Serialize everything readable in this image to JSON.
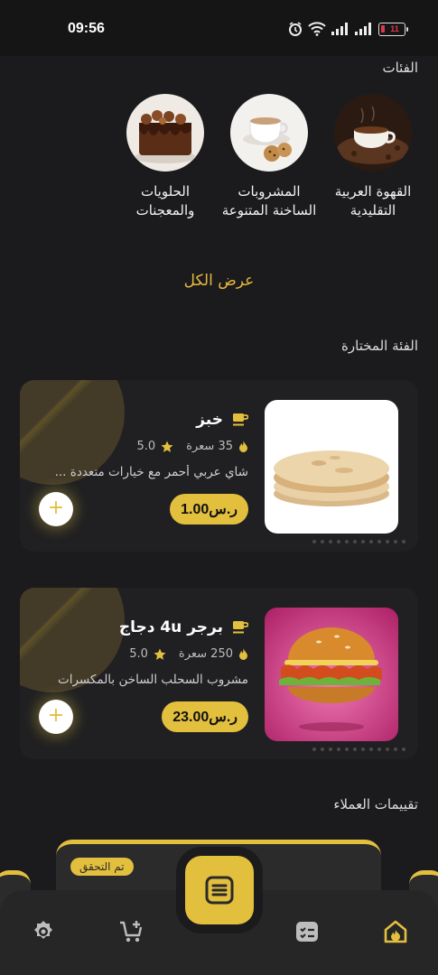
{
  "status_bar": {
    "time": "09:56",
    "battery": "11"
  },
  "categories_section": {
    "title": "الفئات",
    "items": [
      {
        "label": "القهوة العربية التقليدية",
        "icon": "arabic-coffee-photo"
      },
      {
        "label": "المشروبات الساخنة المتنوعة",
        "icon": "hot-drinks-photo"
      },
      {
        "label": "الحلويات والمعجنات",
        "icon": "chocolate-cake-photo"
      }
    ],
    "view_all": "عرض الكل"
  },
  "selected_category": {
    "title": "الفئة المختارة",
    "products": [
      {
        "name": "خبز",
        "calories": "35 سعرة",
        "rating": "5.0",
        "description": "شاي عربي أحمر مع خيارات متعددة ...",
        "price": "ر.س1.00",
        "image": "pita-bread-photo"
      },
      {
        "name": "برجر 4u دجاج",
        "calories": "250 سعرة",
        "rating": "5.0",
        "description": "مشروب السحلب الساخن بالمكسرات",
        "price": "ر.س23.00",
        "image": "chicken-burger-photo"
      }
    ]
  },
  "reviews": {
    "title": "تقييمات العملاء",
    "verified_badge": "تم التحقق"
  },
  "bottom_nav": {
    "items": [
      "home-icon",
      "orders-icon",
      "menu-icon",
      "cart-icon",
      "settings-icon"
    ],
    "active": "home-icon",
    "accent": "#e3bf3e"
  }
}
